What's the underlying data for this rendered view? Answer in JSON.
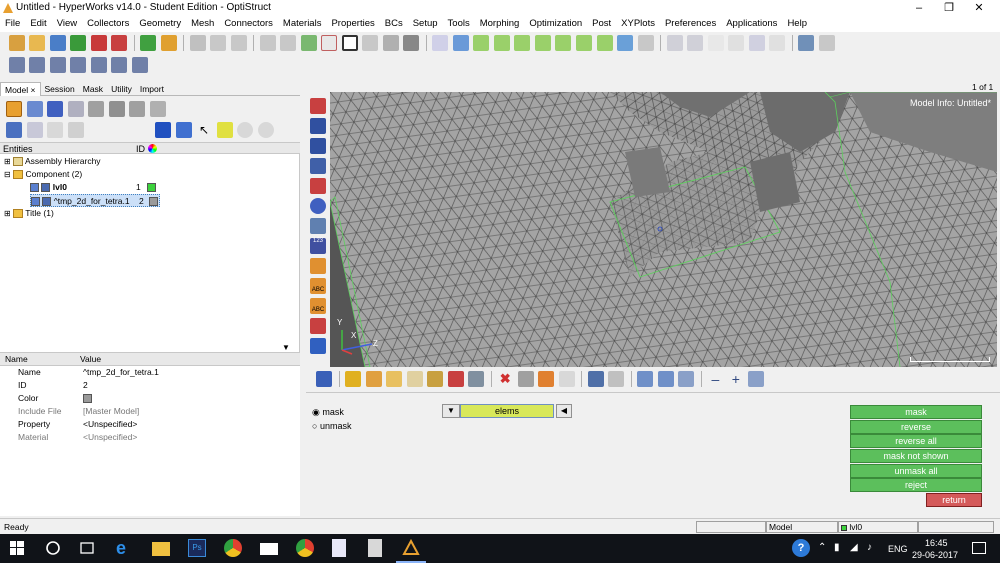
{
  "window": {
    "title": "Untitled - HyperWorks v14.0 - Student Edition - OptiStruct"
  },
  "menu": [
    "File",
    "Edit",
    "View",
    "Collectors",
    "Geometry",
    "Mesh",
    "Connectors",
    "Materials",
    "Properties",
    "BCs",
    "Setup",
    "Tools",
    "Morphing",
    "Optimization",
    "Post",
    "XYPlots",
    "Preferences",
    "Applications",
    "Help"
  ],
  "tabs": {
    "model": "Model",
    "session": "Session",
    "mask": "Mask",
    "utility": "Utility",
    "import": "Import"
  },
  "entities": {
    "header_label": "Entities",
    "id_header": "ID",
    "tree": {
      "assembly": "Assembly Hierarchy",
      "component": "Component (2)",
      "comp1_name": "lvl0",
      "comp1_id": "1",
      "comp1_color": "#3cd23c",
      "comp2_name": "^tmp_2d_for_tetra.1",
      "comp2_id": "2",
      "comp2_color": "#9a9a9a",
      "title": "Title (1)"
    }
  },
  "properties": {
    "header_name": "Name",
    "header_value": "Value",
    "rows": [
      {
        "k": "Name",
        "v": "^tmp_2d_for_tetra.1"
      },
      {
        "k": "ID",
        "v": "2"
      },
      {
        "k": "Color",
        "v": ""
      },
      {
        "k": "Include File",
        "v": "[Master Model]"
      },
      {
        "k": "Property",
        "v": "<Unspecified>"
      },
      {
        "k": "Material",
        "v": "<Unspecified>"
      }
    ]
  },
  "viewport": {
    "page": "1 of 1",
    "model_info": "Model Info: Untitled*",
    "axis_x": "X",
    "axis_y": "Y",
    "axis_z": "Z"
  },
  "panel": {
    "radio_mask": "mask",
    "radio_unmask": "unmask",
    "selector": "elems",
    "buttons": {
      "mask": "mask",
      "reverse": "reverse",
      "reverse_all": "reverse all",
      "mask_not_shown": "mask not shown",
      "unmask_all": "unmask all",
      "reject": "reject",
      "return": "return"
    }
  },
  "status": {
    "ready": "Ready",
    "model": "Model",
    "component": "lvl0"
  },
  "taskbar": {
    "lang": "ENG",
    "time": "16:45",
    "date": "29-06-2017"
  },
  "colors": {
    "green_button": "#5cbf5c",
    "return_button": "#d45a5a",
    "selector": "#d8e85a",
    "mesh_bg": "#8a8a8a"
  }
}
